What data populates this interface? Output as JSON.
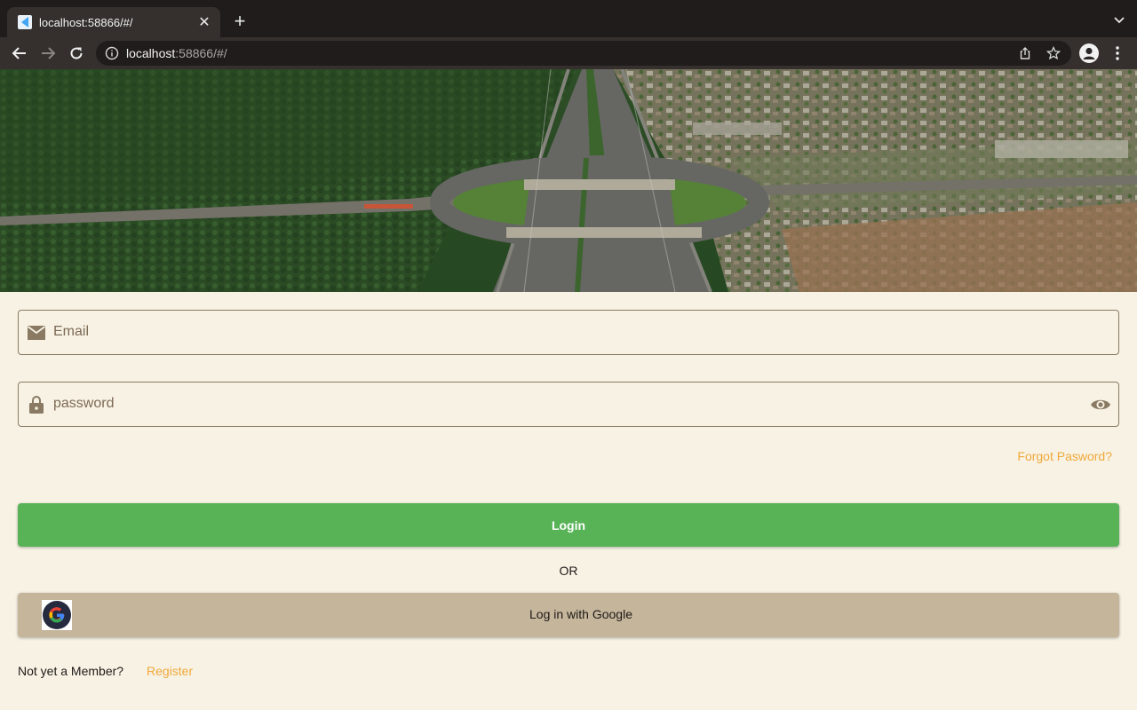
{
  "browser": {
    "tab_title": "localhost:58866/#/",
    "url_host": "localhost",
    "url_rest": ":58866/#/"
  },
  "form": {
    "email_placeholder": "Email",
    "password_placeholder": "password",
    "forgot_label": "Forgot Pasword?",
    "login_label": "Login",
    "or_label": "OR",
    "google_label": "Log in with Google",
    "member_question": "Not yet a Member?",
    "register_label": "Register"
  },
  "colors": {
    "background": "#f7f2e4",
    "login_button": "#58b357",
    "google_button": "#c4b59b",
    "link_accent": "#f0a83a"
  },
  "icons": [
    "flutter-favicon",
    "close-icon",
    "plus-icon",
    "chevron-down-icon",
    "back-arrow-icon",
    "forward-arrow-icon",
    "reload-icon",
    "info-icon",
    "share-icon",
    "star-icon",
    "profile-icon",
    "kebab-menu-icon",
    "mail-icon",
    "lock-icon",
    "eye-icon",
    "google-logo"
  ]
}
